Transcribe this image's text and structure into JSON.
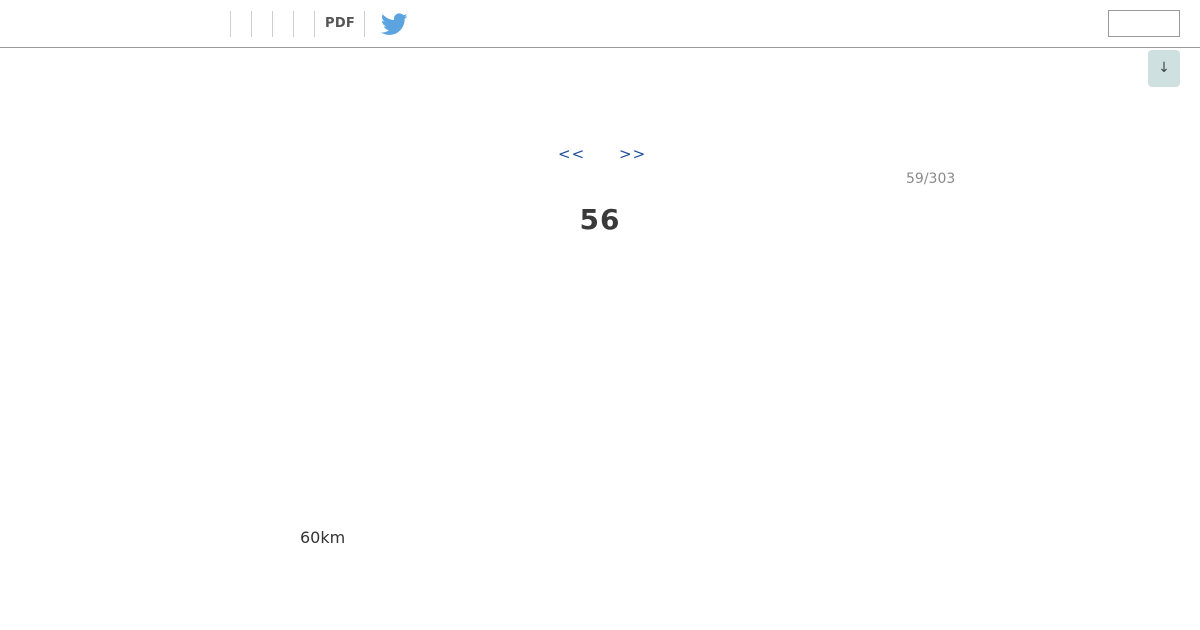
{
  "toolbar": {
    "pdf_label": "PDF",
    "twitter_icon": "twitter-bird-icon",
    "twitter_color": "#5ba4e0",
    "search_value": "",
    "search_placeholder": ""
  },
  "scroll_down": {
    "label": "↓",
    "icon": "arrow-down-icon",
    "bg_color": "#cfe0e0"
  },
  "pager": {
    "prev_label": "<<",
    "next_label": ">>",
    "counter": "59/303",
    "link_color": "#1f4e9a"
  },
  "content": {
    "page_number": "56",
    "scale_label": "60km"
  }
}
